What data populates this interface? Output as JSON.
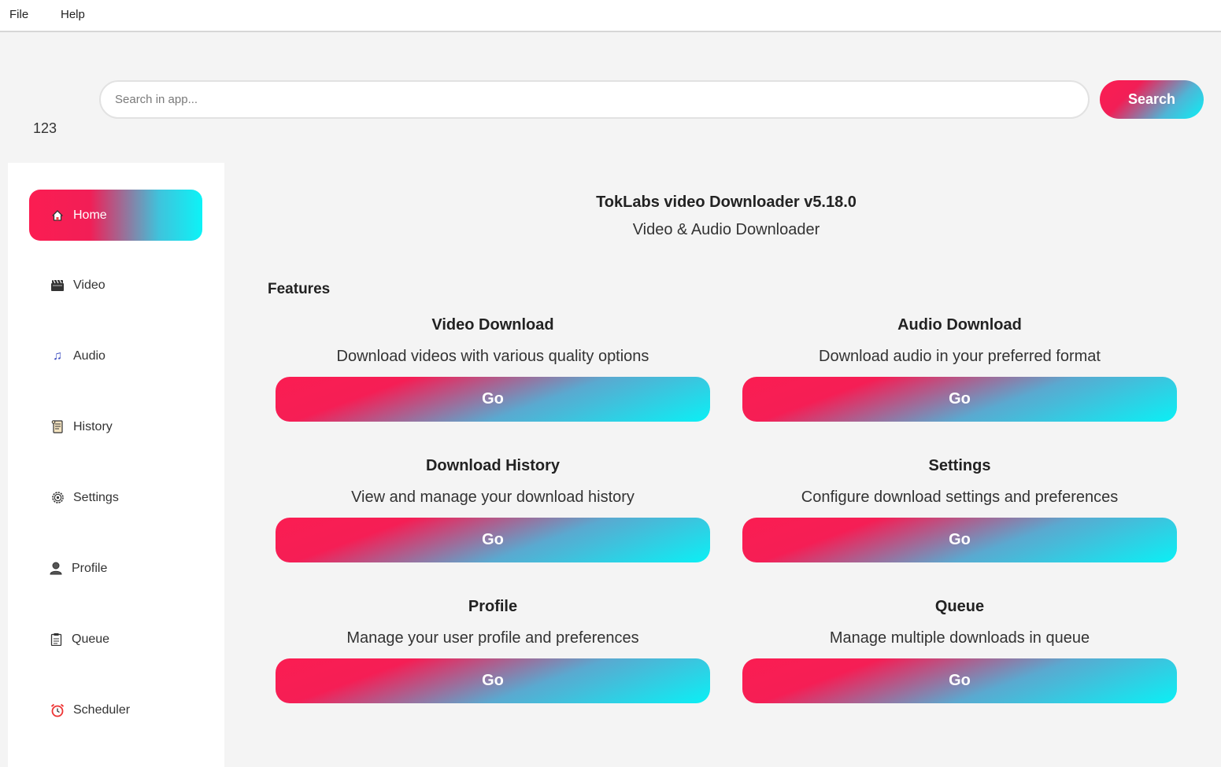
{
  "menubar": {
    "file": "File",
    "help": "Help"
  },
  "search": {
    "placeholder": "Search in app...",
    "value": "",
    "button_label": "Search"
  },
  "counter": "123",
  "sidebar": {
    "items": [
      {
        "label": "Home",
        "icon": "home-icon",
        "active": true
      },
      {
        "label": "Video",
        "icon": "video-icon",
        "active": false
      },
      {
        "label": "Audio",
        "icon": "music-note-icon",
        "active": false
      },
      {
        "label": "History",
        "icon": "scroll-icon",
        "active": false
      },
      {
        "label": "Settings",
        "icon": "gear-icon",
        "active": false
      },
      {
        "label": "Profile",
        "icon": "user-icon",
        "active": false
      },
      {
        "label": "Queue",
        "icon": "clipboard-icon",
        "active": false
      },
      {
        "label": "Scheduler",
        "icon": "alarm-clock-icon",
        "active": false
      }
    ]
  },
  "main": {
    "title": "TokLabs video Downloader v5.18.0",
    "subtitle": "Video & Audio Downloader",
    "features_heading": "Features",
    "cards": [
      {
        "title": "Video Download",
        "description": "Download videos with various quality options",
        "button_label": "Go"
      },
      {
        "title": "Audio Download",
        "description": "Download audio in your preferred format",
        "button_label": "Go"
      },
      {
        "title": "Download History",
        "description": "View and manage your download history",
        "button_label": "Go"
      },
      {
        "title": "Settings",
        "description": "Configure download settings and preferences",
        "button_label": "Go"
      },
      {
        "title": "Profile",
        "description": "Manage your user profile and preferences",
        "button_label": "Go"
      },
      {
        "title": "Queue",
        "description": "Manage multiple downloads in queue",
        "button_label": "Go"
      }
    ]
  },
  "colors": {
    "accent_pink": "#fb1d52",
    "accent_cyan": "#0af0f5",
    "background": "#f4f4f4",
    "sidebar_bg": "#ffffff"
  }
}
